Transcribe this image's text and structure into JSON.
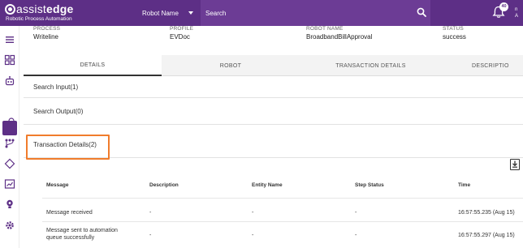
{
  "header": {
    "logo_word_1": "assist",
    "logo_word_2": "edge",
    "logo_subtitle": "Robotic Process Automation",
    "robot_select_label": "Robot Name",
    "search_placeholder": "Search",
    "notification_count": "40",
    "user_line_1": "n",
    "user_line_2": "A",
    "brand_color": "#5d2f86"
  },
  "sidebar": {
    "items": [
      {
        "icon": "menu-icon"
      },
      {
        "icon": "dashboard-grid-icon"
      },
      {
        "icon": "robot-icon"
      },
      {
        "icon": "process-tree-icon",
        "active": true
      },
      {
        "icon": "key-icon"
      },
      {
        "icon": "workflow-icon"
      },
      {
        "icon": "diamond-icon"
      },
      {
        "icon": "report-chart-icon"
      },
      {
        "icon": "idea-bulb-icon"
      },
      {
        "icon": "settings-icon"
      }
    ]
  },
  "summary": {
    "process_label": "PROCESS",
    "process_value": "Writeline",
    "profile_label": "PROFILE",
    "profile_value": "EVDoc",
    "robot_label": "ROBOT NAME",
    "robot_value": "BroadbandBillApproval",
    "status_label": "STATUS",
    "status_value": "success"
  },
  "tabs": [
    {
      "label": "DETAILS",
      "active": true
    },
    {
      "label": "ROBOT",
      "active": false
    },
    {
      "label": "TRANSACTION DETAILS",
      "active": false
    },
    {
      "label": "DESCRIPTIO",
      "active": false
    }
  ],
  "sections": {
    "search_input": "Search Input(1)",
    "search_output": "Search Output(0)",
    "transaction_details": "Transaction Details(2)"
  },
  "highlight_color": "#f07c2c",
  "table": {
    "headers": [
      "Message",
      "Description",
      "Entity Name",
      "Step Status",
      "Time"
    ],
    "rows": [
      {
        "message": "Message received",
        "description": "-",
        "entity": "-",
        "step_status": "-",
        "time": "16:57:55.235 (Aug 15)"
      },
      {
        "message_line_1": "Message sent to automation",
        "message_line_2": "queue successfully",
        "description": "-",
        "entity": "-",
        "step_status": "-",
        "time": "16:57:55.297 (Aug 15)"
      }
    ]
  }
}
